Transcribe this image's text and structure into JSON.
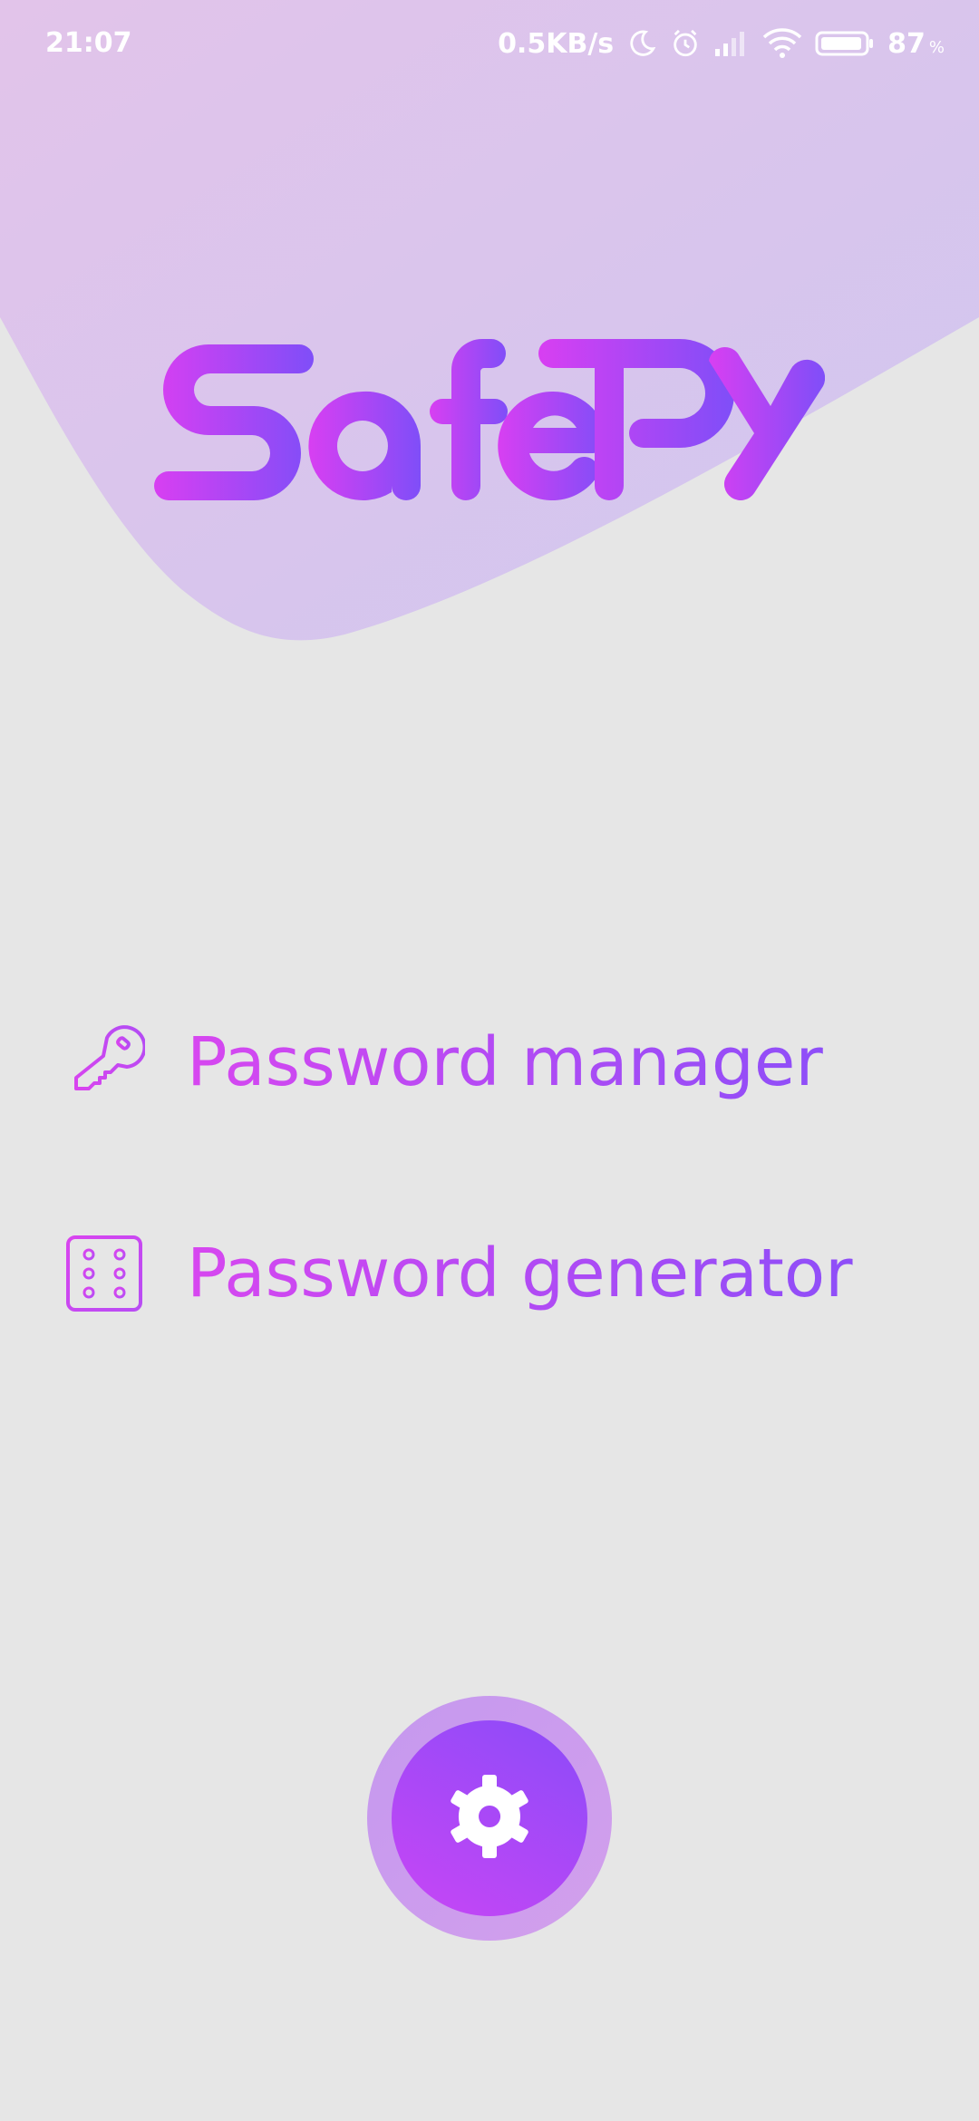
{
  "status_bar": {
    "time": "21:07",
    "network_speed": "0.5KB/s",
    "battery_percent": "87",
    "battery_unit": "%",
    "icons": [
      "moon-icon",
      "alarm-icon",
      "signal-icon",
      "wifi-icon",
      "battery-icon"
    ]
  },
  "brand": {
    "logo_text": "SafePY",
    "gradient_start": "#d83ff2",
    "gradient_end": "#7f4ef8"
  },
  "menu": {
    "items": [
      {
        "label": "Password manager",
        "icon": "key-icon"
      },
      {
        "label": "Password generator",
        "icon": "dice-icon"
      }
    ]
  },
  "settings": {
    "icon": "gear-icon"
  },
  "colors": {
    "background": "#e6e6e6",
    "accent_pink": "#d747f0",
    "accent_purple": "#8e4ef8"
  }
}
